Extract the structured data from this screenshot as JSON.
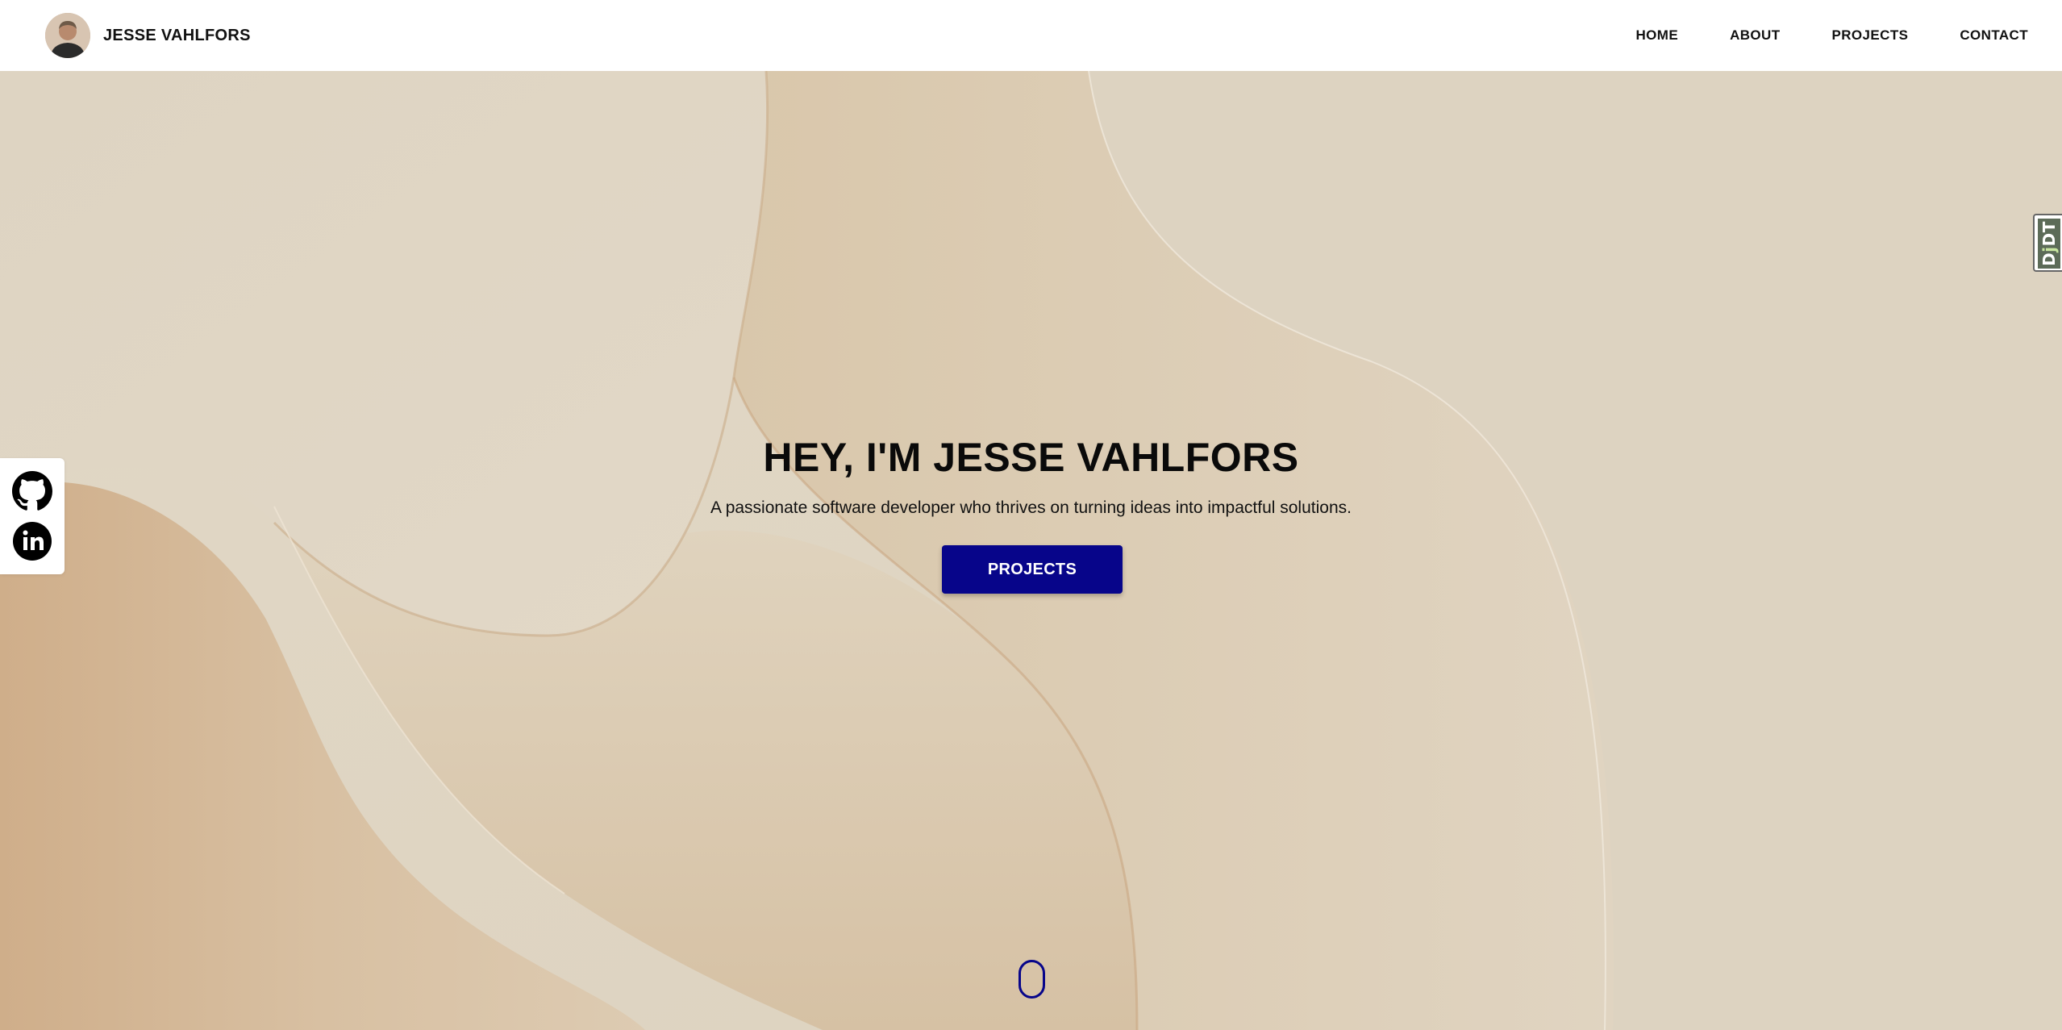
{
  "header": {
    "brand_name": "JESSE VAHLFORS",
    "nav": [
      {
        "label": "HOME"
      },
      {
        "label": "ABOUT"
      },
      {
        "label": "PROJECTS"
      },
      {
        "label": "CONTACT"
      }
    ]
  },
  "hero": {
    "title": "HEY, I'M JESSE VAHLFORS",
    "subtitle": "A passionate software developer who thrives on turning ideas into impactful solutions.",
    "button_label": "PROJECTS"
  },
  "social": {
    "icons": [
      "github-icon",
      "linkedin-icon"
    ]
  },
  "debug_toolbar": {
    "label_prefix": "D",
    "label_accent": "j",
    "label_suffix": "DT"
  },
  "colors": {
    "accent": "#07058a",
    "header_bg": "#ffffff",
    "hero_bg": "#e6dccb",
    "text": "#0a0a0a"
  }
}
